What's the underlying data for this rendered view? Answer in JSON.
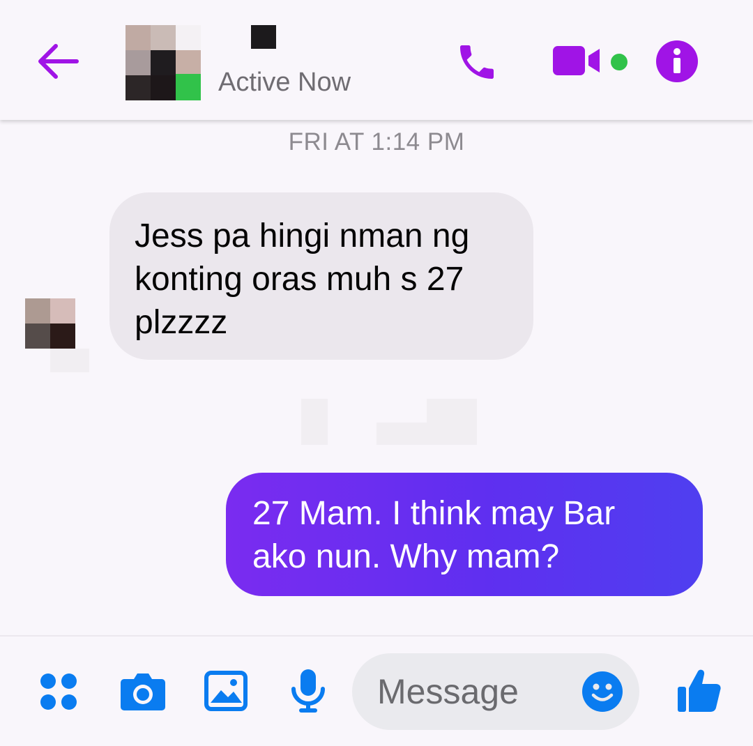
{
  "header": {
    "status": "Active Now",
    "colors": {
      "accent": "#a014e6",
      "online": "#31c24a"
    },
    "icons": [
      "back-arrow-icon",
      "phone-icon",
      "video-camera-icon",
      "info-icon"
    ]
  },
  "conversation": {
    "timestamp": "FRI AT 1:14 PM",
    "messages": [
      {
        "direction": "incoming",
        "lines": [
          "Jess pa hingi nman ng",
          "konting oras muh s 27",
          "plzzzz"
        ]
      },
      {
        "direction": "outgoing",
        "lines": [
          "27 Mam. I think may Bar",
          "ako nun. Why mam?"
        ]
      }
    ]
  },
  "composer": {
    "placeholder": "Message",
    "icons": [
      "more-apps-icon",
      "camera-icon",
      "gallery-icon",
      "microphone-icon",
      "emoji-icon",
      "thumbs-up-icon"
    ],
    "colors": {
      "tool": "#0a7cf0"
    }
  }
}
